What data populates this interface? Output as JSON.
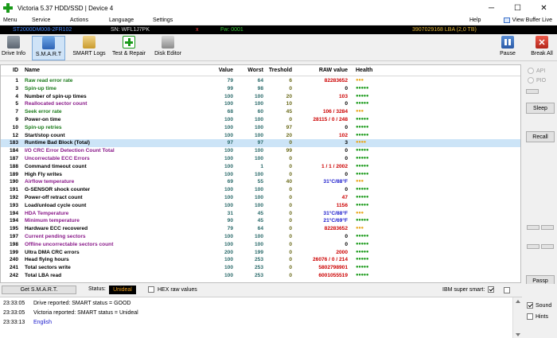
{
  "window": {
    "title": "Victoria 5.37 HDD/SSD | Device 4",
    "minimize": "─",
    "maximize": "☐",
    "close": "✕"
  },
  "menu": {
    "items": [
      "Menu",
      "Service",
      "Actions",
      "Language",
      "Settings"
    ],
    "help": "Help",
    "view_buffer": "View Buffer Live"
  },
  "drive": {
    "model": "ST2000DM008-2FR102",
    "serial": "SN: WFL1J7PK",
    "x": "x",
    "firmware": "Fw: 0001",
    "lba": "3907029168 LBA (2,0 TB)",
    "colors": {
      "model": "#4a8cff",
      "serial": "#dcdcdc",
      "x": "#ff4040",
      "firmware": "#38c938",
      "lba": "#e8b93a"
    }
  },
  "toolbar": {
    "drive_info": "Drive Info",
    "smart": "S.M.A.R.T",
    "smart_logs": "SMART Logs",
    "test_repair": "Test & Repair",
    "disk_editor": "Disk Editor",
    "pause": "Pause",
    "break_all": "Break All"
  },
  "table": {
    "headers": {
      "id": "ID",
      "name": "Name",
      "value": "Value",
      "worst": "Worst",
      "threshold": "Treshold",
      "raw": "RAW value",
      "health": "Health"
    },
    "rows": [
      {
        "id": "1",
        "name": "Raw read error rate",
        "value": "79",
        "worst": "64",
        "threshold": "6",
        "raw": "82283652",
        "health": "●●●",
        "color": "#1a7a1a",
        "raw_color": "#cc0000",
        "health_color": "#e8a820"
      },
      {
        "id": "3",
        "name": "Spin-up time",
        "value": "99",
        "worst": "98",
        "threshold": "0",
        "raw": "0",
        "health": "●●●●●",
        "color": "#1a7a1a",
        "raw_color": "#000000",
        "health_color": "#1a9a1a"
      },
      {
        "id": "4",
        "name": "Number of spin-up times",
        "value": "100",
        "worst": "100",
        "threshold": "20",
        "raw": "103",
        "health": "●●●●●",
        "color": "#000000",
        "raw_color": "#cc0000",
        "health_color": "#1a9a1a"
      },
      {
        "id": "5",
        "name": "Reallocated sector count",
        "value": "100",
        "worst": "100",
        "threshold": "10",
        "raw": "0",
        "health": "●●●●●",
        "color": "#8a1a8a",
        "raw_color": "#000000",
        "health_color": "#1a9a1a"
      },
      {
        "id": "7",
        "name": "Seek error rate",
        "value": "68",
        "worst": "60",
        "threshold": "45",
        "raw": "106 / 3284",
        "health": "●●●",
        "color": "#1a7a1a",
        "raw_color": "#cc0000",
        "health_color": "#e8a820"
      },
      {
        "id": "9",
        "name": "Power-on time",
        "value": "100",
        "worst": "100",
        "threshold": "0",
        "raw": "28115 / 0 / 248",
        "health": "●●●●●",
        "color": "#000000",
        "raw_color": "#cc0000",
        "health_color": "#1a9a1a"
      },
      {
        "id": "10",
        "name": "Spin-up retries",
        "value": "100",
        "worst": "100",
        "threshold": "97",
        "raw": "0",
        "health": "●●●●●",
        "color": "#1a7a1a",
        "raw_color": "#000000",
        "health_color": "#1a9a1a"
      },
      {
        "id": "12",
        "name": "Start/stop count",
        "value": "100",
        "worst": "100",
        "threshold": "20",
        "raw": "102",
        "health": "●●●●●",
        "color": "#000000",
        "raw_color": "#cc0000",
        "health_color": "#1a9a1a"
      },
      {
        "id": "183",
        "name": "Runtime Bad Block (Total)",
        "value": "97",
        "worst": "97",
        "threshold": "0",
        "raw": "3",
        "health": "●●●●",
        "color": "#000000",
        "raw_color": "#000000",
        "health_color": "#e8a820",
        "selected": true
      },
      {
        "id": "184",
        "name": "I/O CRC Error Detection Count Total",
        "value": "100",
        "worst": "100",
        "threshold": "99",
        "raw": "0",
        "health": "●●●●●",
        "color": "#8a1a8a",
        "raw_color": "#000000",
        "health_color": "#1a9a1a"
      },
      {
        "id": "187",
        "name": "Uncorrectable ECC Errors",
        "value": "100",
        "worst": "100",
        "threshold": "0",
        "raw": "0",
        "health": "●●●●●",
        "color": "#8a1a8a",
        "raw_color": "#000000",
        "health_color": "#1a9a1a"
      },
      {
        "id": "188",
        "name": "Command timeout count",
        "value": "100",
        "worst": "1",
        "threshold": "0",
        "raw": "1 / 1 / 2002",
        "health": "●●●●●",
        "color": "#000000",
        "raw_color": "#cc0000",
        "health_color": "#1a9a1a"
      },
      {
        "id": "189",
        "name": "High Fly writes",
        "value": "100",
        "worst": "100",
        "threshold": "0",
        "raw": "0",
        "health": "●●●●●",
        "color": "#000000",
        "raw_color": "#000000",
        "health_color": "#1a9a1a"
      },
      {
        "id": "190",
        "name": "Airflow temperature",
        "value": "69",
        "worst": "55",
        "threshold": "40",
        "raw": "31°C/88°F",
        "health": "●●●",
        "color": "#8a1a8a",
        "raw_color": "#1a1acc",
        "health_color": "#e8a820"
      },
      {
        "id": "191",
        "name": "G-SENSOR shock counter",
        "value": "100",
        "worst": "100",
        "threshold": "0",
        "raw": "0",
        "health": "●●●●●",
        "color": "#000000",
        "raw_color": "#000000",
        "health_color": "#1a9a1a"
      },
      {
        "id": "192",
        "name": "Power-off retract count",
        "value": "100",
        "worst": "100",
        "threshold": "0",
        "raw": "47",
        "health": "●●●●●",
        "color": "#000000",
        "raw_color": "#cc0000",
        "health_color": "#1a9a1a"
      },
      {
        "id": "193",
        "name": "Load/unload cycle count",
        "value": "100",
        "worst": "100",
        "threshold": "0",
        "raw": "1156",
        "health": "●●●●●",
        "color": "#000000",
        "raw_color": "#cc0000",
        "health_color": "#1a9a1a"
      },
      {
        "id": "194",
        "name": "HDA Temperature",
        "value": "31",
        "worst": "45",
        "threshold": "0",
        "raw": "31°C/88°F",
        "health": "●●●",
        "color": "#8a1a8a",
        "raw_color": "#1a1acc",
        "health_color": "#e8a820"
      },
      {
        "id": "194",
        "name": "Minimum temperature",
        "value": "90",
        "worst": "45",
        "threshold": "0",
        "raw": "21°C/69°F",
        "health": "●●●●●",
        "color": "#8a1a8a",
        "raw_color": "#1a1acc",
        "health_color": "#1a9a1a"
      },
      {
        "id": "195",
        "name": "Hardware ECC recovered",
        "value": "79",
        "worst": "64",
        "threshold": "0",
        "raw": "82283652",
        "health": "●●●",
        "color": "#000000",
        "raw_color": "#cc0000",
        "health_color": "#e8a820"
      },
      {
        "id": "197",
        "name": "Current pending sectors",
        "value": "100",
        "worst": "100",
        "threshold": "0",
        "raw": "0",
        "health": "●●●●●",
        "color": "#8a1a8a",
        "raw_color": "#000000",
        "health_color": "#1a9a1a"
      },
      {
        "id": "198",
        "name": "Offline uncorrectable sectors count",
        "value": "100",
        "worst": "100",
        "threshold": "0",
        "raw": "0",
        "health": "●●●●●",
        "color": "#8a1a8a",
        "raw_color": "#000000",
        "health_color": "#1a9a1a"
      },
      {
        "id": "199",
        "name": "Ultra DMA CRC errors",
        "value": "200",
        "worst": "199",
        "threshold": "0",
        "raw": "2000",
        "health": "●●●●●",
        "color": "#000000",
        "raw_color": "#cc0000",
        "health_color": "#1a9a1a"
      },
      {
        "id": "240",
        "name": "Head flying hours",
        "value": "100",
        "worst": "253",
        "threshold": "0",
        "raw": "26076 / 0 / 214",
        "health": "●●●●●",
        "color": "#000000",
        "raw_color": "#cc0000",
        "health_color": "#1a9a1a"
      },
      {
        "id": "241",
        "name": "Total sectors write",
        "value": "100",
        "worst": "253",
        "threshold": "0",
        "raw": "5802798901",
        "health": "●●●●●",
        "color": "#000000",
        "raw_color": "#cc0000",
        "health_color": "#1a9a1a"
      },
      {
        "id": "242",
        "name": "Total LBA read",
        "value": "100",
        "worst": "253",
        "threshold": "0",
        "raw": "6001055519",
        "health": "●●●●●",
        "color": "#000000",
        "raw_color": "#cc0000",
        "health_color": "#1a9a1a"
      }
    ]
  },
  "right_panel": {
    "api": "API",
    "pio": "PIO",
    "sleep": "Sleep",
    "recall": "Recall",
    "passp": "Passp"
  },
  "status_row": {
    "get_smart": "Get S.M.A.R.T.",
    "status_label": "Status:",
    "status_value": "Unideal",
    "hex_raw": "HEX raw values",
    "ibm_super_smart": "IBM super smart:"
  },
  "log": {
    "lines": [
      {
        "time": "23:33:05",
        "text": "Drive reported: SMART status = GOOD",
        "color": "#000000"
      },
      {
        "time": "23:33:05",
        "text": "Victoria reported: SMART status = Unideal",
        "color": "#000000"
      },
      {
        "time": "23:33:13",
        "text": "English",
        "color": "#1a1acc"
      }
    ]
  },
  "options": {
    "sound": "Sound",
    "hints": "Hints"
  }
}
